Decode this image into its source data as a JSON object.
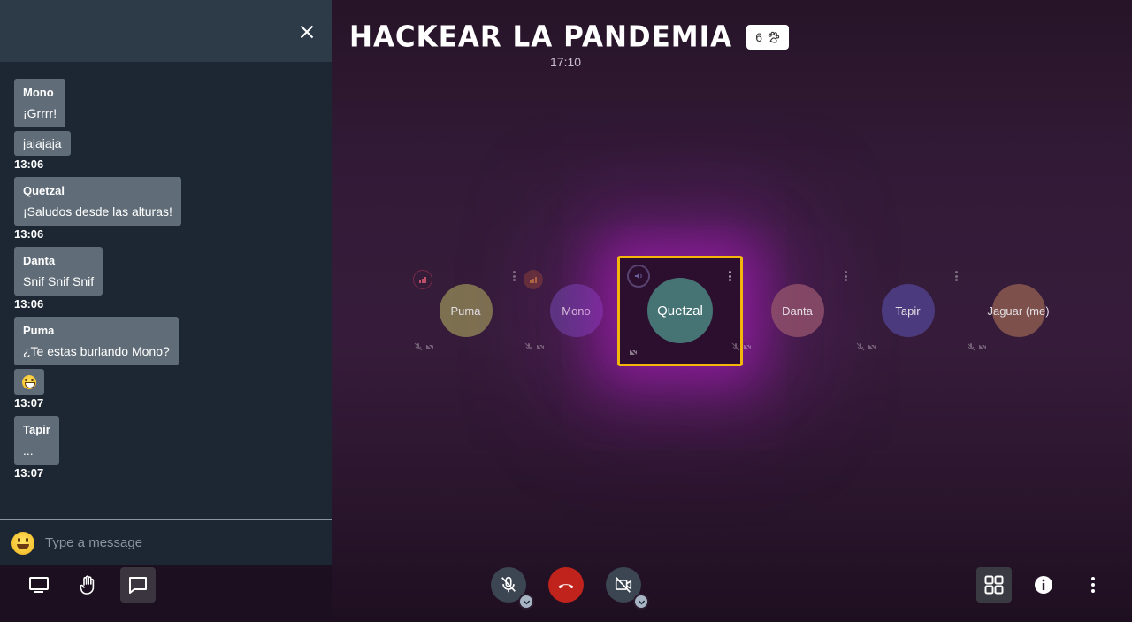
{
  "room": {
    "title": "Hackear la pandemia",
    "participant_count": "6",
    "time": "17:10"
  },
  "participants": [
    {
      "name": "Puma",
      "color": "#8a7f55"
    },
    {
      "name": "Mono",
      "color": "#5e3d8a"
    },
    {
      "name": "Quetzal",
      "color": "#467475",
      "active": true
    },
    {
      "name": "Danta",
      "color": "#8e4f6a"
    },
    {
      "name": "Tapir",
      "color": "#50408a"
    },
    {
      "name": "Jaguar (me)",
      "color": "#8a5a50"
    }
  ],
  "chat": {
    "messages": [
      {
        "sender": "Mono",
        "text": "¡Grrrr!"
      },
      {
        "text": "jajajaja",
        "time": "13:06"
      },
      {
        "sender": "Quetzal",
        "text": "¡Saludos desde las alturas!",
        "time": "13:06"
      },
      {
        "sender": "Danta",
        "text": "Snif Snif Snif",
        "time": "13:06"
      },
      {
        "sender": "Puma",
        "text": "¿Te estas burlando Mono?"
      },
      {
        "text": "emoji-grin",
        "time": "13:07"
      },
      {
        "sender": "Tapir",
        "text": "...",
        "time": "13:07"
      }
    ],
    "input_placeholder": "Type a message"
  },
  "colors": {
    "accent_active_border": "#f2b70a",
    "hangup": "#c0231c",
    "chat_panel": "#1c2733",
    "bubble": "#606d78"
  },
  "icons": {
    "close": "close-icon",
    "share_screen": "desktop-icon",
    "raise_hand": "hand-icon",
    "chat": "chat-icon",
    "mic": "mic-off-icon",
    "hangup": "phone-hangup-icon",
    "camera": "camera-off-icon",
    "tile_view": "grid-icon",
    "info": "info-icon",
    "more": "more-vertical-icon"
  }
}
